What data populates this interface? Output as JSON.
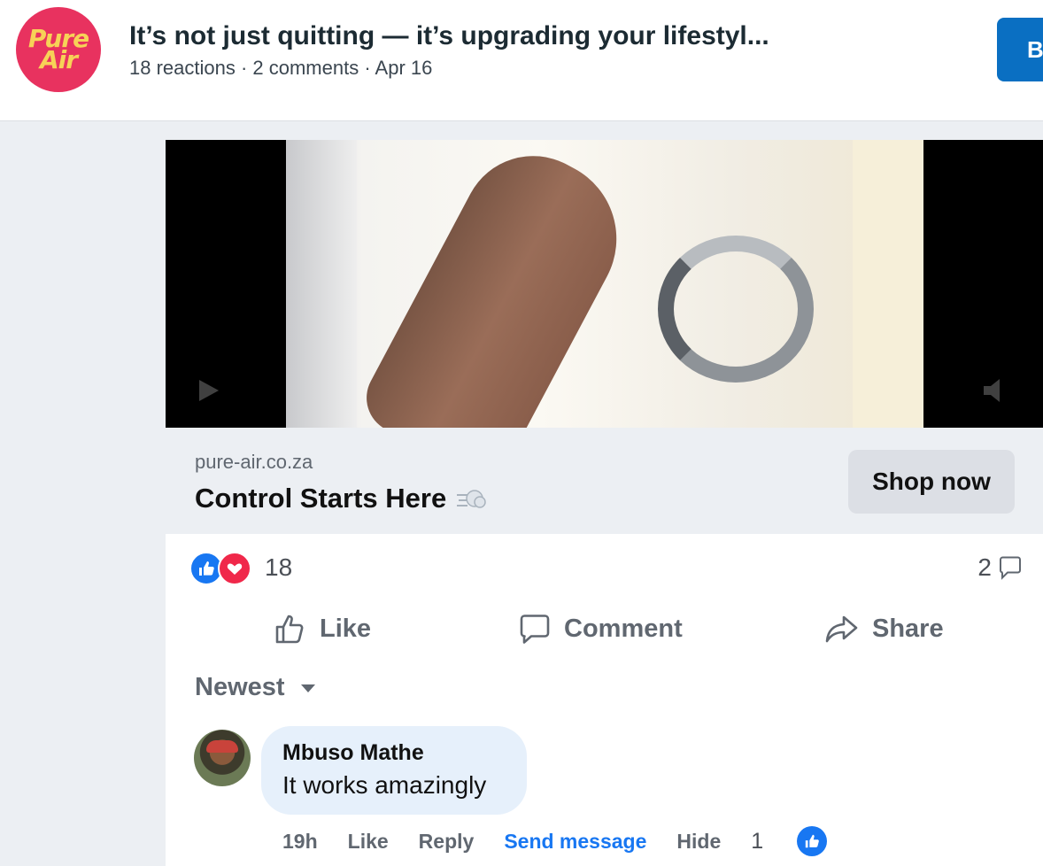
{
  "header": {
    "logo_line1": "Pure",
    "logo_line2": "Air",
    "title": "It’s not just quitting — it’s upgrading your lifestyl...",
    "meta": "18 reactions · 2 comments · Apr 16",
    "button_label": "B"
  },
  "link_preview": {
    "domain": "pure-air.co.za",
    "headline": "Control Starts Here",
    "cta": "Shop now"
  },
  "reactions": {
    "count": "18",
    "comments": "2"
  },
  "actions": {
    "like": "Like",
    "comment": "Comment",
    "share": "Share"
  },
  "comments": {
    "sort": "Newest",
    "items": [
      {
        "author": "Mbuso Mathe",
        "text": "It works amazingly",
        "time": "19h",
        "like": "Like",
        "reply": "Reply",
        "send": "Send message",
        "hide": "Hide",
        "likes": "1"
      }
    ]
  },
  "colors": {
    "accent": "#1877f2",
    "brand_logo": "#e8325f",
    "love": "#f0284a",
    "bubble": "#e6f0fb"
  }
}
